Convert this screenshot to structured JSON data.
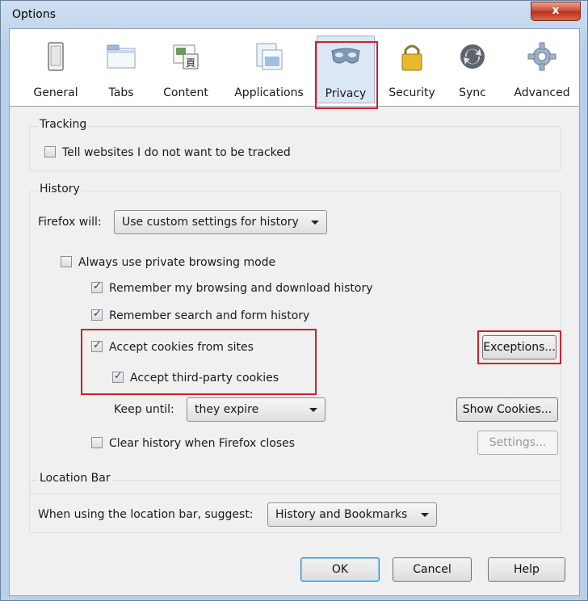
{
  "window": {
    "title": "Options",
    "close_symbol": "x"
  },
  "toolbar": {
    "panes": [
      {
        "label": "General",
        "icon": "general-icon"
      },
      {
        "label": "Tabs",
        "icon": "tabs-icon"
      },
      {
        "label": "Content",
        "icon": "content-icon"
      },
      {
        "label": "Applications",
        "icon": "applications-icon"
      },
      {
        "label": "Privacy",
        "icon": "privacy-mask-icon",
        "selected": true
      },
      {
        "label": "Security",
        "icon": "lock-icon"
      },
      {
        "label": "Sync",
        "icon": "sync-icon"
      },
      {
        "label": "Advanced",
        "icon": "gear-icon"
      }
    ]
  },
  "tracking": {
    "group_title": "Tracking",
    "do_not_track_label": "Tell websites I do not want to be tracked",
    "do_not_track_checked": false
  },
  "history": {
    "group_title": "History",
    "firefox_will_label": "Firefox will:",
    "mode_value": "Use custom settings for history",
    "private_mode_label": "Always use private browsing mode",
    "private_mode_checked": false,
    "remember_browsing_label": "Remember my browsing and download history",
    "remember_browsing_checked": true,
    "remember_search_label": "Remember search and form history",
    "remember_search_checked": true,
    "accept_cookies_label": "Accept cookies from sites",
    "accept_cookies_checked": true,
    "third_party_label": "Accept third-party cookies",
    "third_party_checked": true,
    "exceptions_label": "Exceptions...",
    "keep_until_label": "Keep until:",
    "keep_until_value": "they expire",
    "show_cookies_label": "Show Cookies...",
    "clear_on_close_label": "Clear history when Firefox closes",
    "clear_on_close_checked": false,
    "settings_label": "Settings..."
  },
  "location_bar": {
    "group_title": "Location Bar",
    "suggest_label": "When using the location bar, suggest:",
    "suggest_value": "History and Bookmarks"
  },
  "footer": {
    "ok_label": "OK",
    "cancel_label": "Cancel",
    "help_label": "Help"
  },
  "colors": {
    "highlight": "#d0202b",
    "title_bg": "#b9d0ea",
    "dialog_bg": "#f0f0f0"
  }
}
